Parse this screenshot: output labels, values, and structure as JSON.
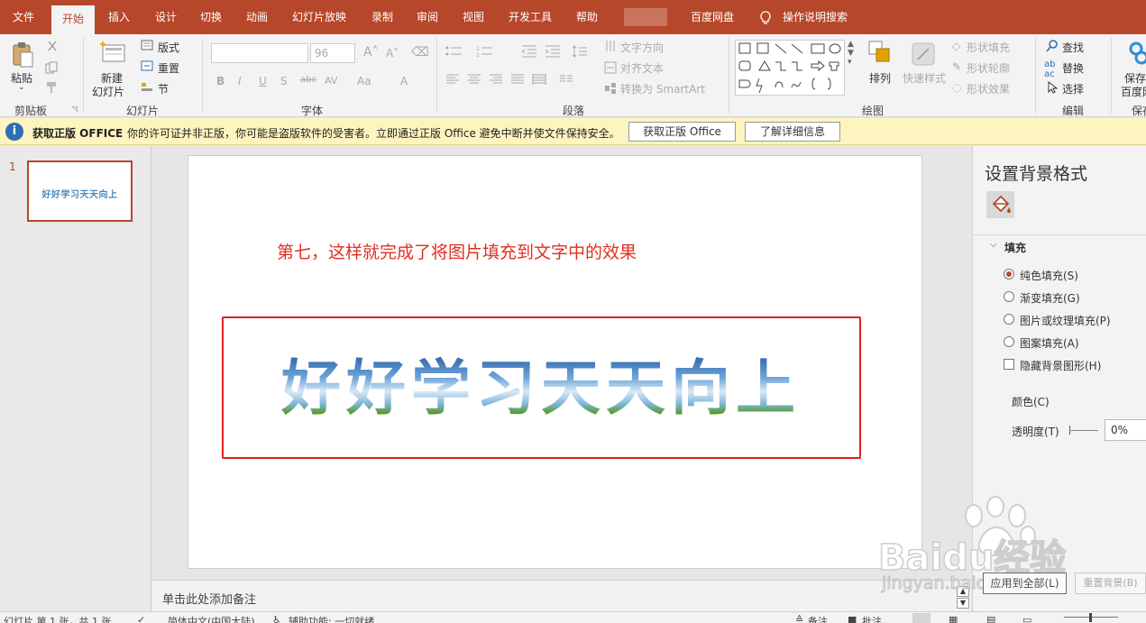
{
  "tabs": [
    "文件",
    "开始",
    "插入",
    "设计",
    "切换",
    "动画",
    "幻灯片放映",
    "录制",
    "审阅",
    "视图",
    "开发工具",
    "帮助",
    "百度网盘"
  ],
  "tell_me": "操作说明搜索",
  "ribbon": {
    "clipboard": {
      "paste": "粘贴",
      "label": "剪贴板"
    },
    "slides": {
      "new_slide_1": "新建",
      "new_slide_2": "幻灯片",
      "layout": "版式",
      "reset": "重置",
      "section": "节",
      "label": "幻灯片"
    },
    "font": {
      "size": "96",
      "label": "字体"
    },
    "paragraph": {
      "text_direction": "文字方向",
      "align_text": "对齐文本",
      "smartart": "转换为 SmartArt",
      "label": "段落"
    },
    "drawing": {
      "arrange": "排列",
      "quick_styles": "快速样式",
      "shape_fill": "形状填充",
      "shape_outline": "形状轮廓",
      "shape_effects": "形状效果",
      "label": "绘图"
    },
    "editing": {
      "find": "查找",
      "replace": "替换",
      "select": "选择",
      "label": "编辑"
    },
    "save": {
      "line1": "保存",
      "line2": "百度网",
      "label": "保存"
    }
  },
  "warning": {
    "title": "获取正版 OFFICE",
    "message": "你的许可证并非正版，你可能是盗版软件的受害者。立即通过正版 Office 避免中断并使文件保持安全。",
    "btn_get": "获取正版 Office",
    "btn_more": "了解详细信息"
  },
  "thumbnail": {
    "number": "1",
    "text": "好好学习天天向上"
  },
  "slide": {
    "caption": "第七，这样就完成了将图片填充到文字中的效果",
    "wordart": "好好学习天天向上"
  },
  "notes_placeholder": "单击此处添加备注",
  "pane": {
    "title": "设置背景格式",
    "section": "填充",
    "options": [
      "纯色填充(S)",
      "渐变填充(G)",
      "图片或纹理填充(P)",
      "图案填充(A)"
    ],
    "hide_bg": "隐藏背景图形(H)",
    "color": "颜色(C)",
    "transparency": "透明度(T)",
    "transparency_value": "0%",
    "apply_all": "应用到全部(L)",
    "reset_bg": "重置背景(B)"
  },
  "status": {
    "slide": "幻灯片 第 1 张，共 1 张",
    "lang": "简体中文(中国大陆)",
    "access": "辅助功能: 一切就绪",
    "notes": "备注",
    "comments": "批注"
  },
  "watermark": {
    "brand": "Baidu经验",
    "url": "jingyan.baidu.com"
  },
  "colors": {
    "accent": "#b7472a",
    "caption": "#e03020",
    "frame": "#e02020"
  }
}
